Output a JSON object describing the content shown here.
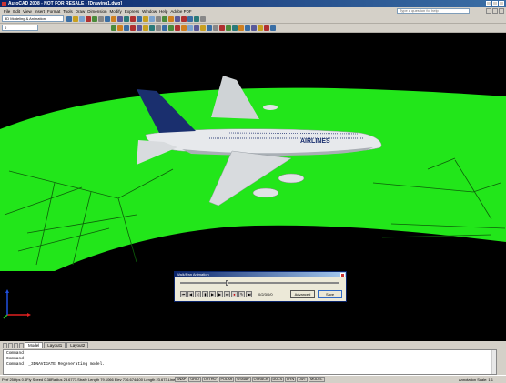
{
  "window": {
    "title": "AutoCAD 2008 - NOT FOR RESALE - [Drawing1.dwg]"
  },
  "menu": {
    "items": [
      "File",
      "Edit",
      "View",
      "Insert",
      "Format",
      "Tools",
      "Draw",
      "Dimension",
      "Modify",
      "Express",
      "Window",
      "Help",
      "Adobe PDF"
    ],
    "help_placeholder": "Type a question for help"
  },
  "toolbar": {
    "workspace": "3D Modeling & Animation",
    "layer": "0"
  },
  "dialog": {
    "title": "Walk/Pan Animation",
    "frame_label": "of",
    "frame_value": "0/2/3/0/0",
    "advanced_label": "Advanced",
    "save_label": "Save"
  },
  "tabs": {
    "items": [
      "Model",
      "Layout1",
      "Layout2"
    ],
    "active": "Model"
  },
  "command": {
    "lines": [
      "Command:",
      "Command:",
      "Command: _3DNAVIGATE Regenerating model."
    ]
  },
  "status": {
    "coords": "Perf 256fps 0.4Fly Speed 0.38Radius 23.6773.Strafe Length 79.1066 Elev 736.674/100 Length 23.673.Line Length 21.938",
    "modes": [
      "SNAP",
      "GRID",
      "ORTHO",
      "POLAR",
      "OSNAP",
      "OTRACK",
      "DUCS",
      "DYN",
      "LWT",
      "MODEL"
    ],
    "annotation_scale": "Annotation Scale: 1:1"
  },
  "livery": {
    "text": "AIRLINES"
  },
  "colors": {
    "viewport_bg": "#000000",
    "ground": "#22e61a",
    "tail": "#1a2f6e",
    "fuselage": "#e7e9ec"
  }
}
